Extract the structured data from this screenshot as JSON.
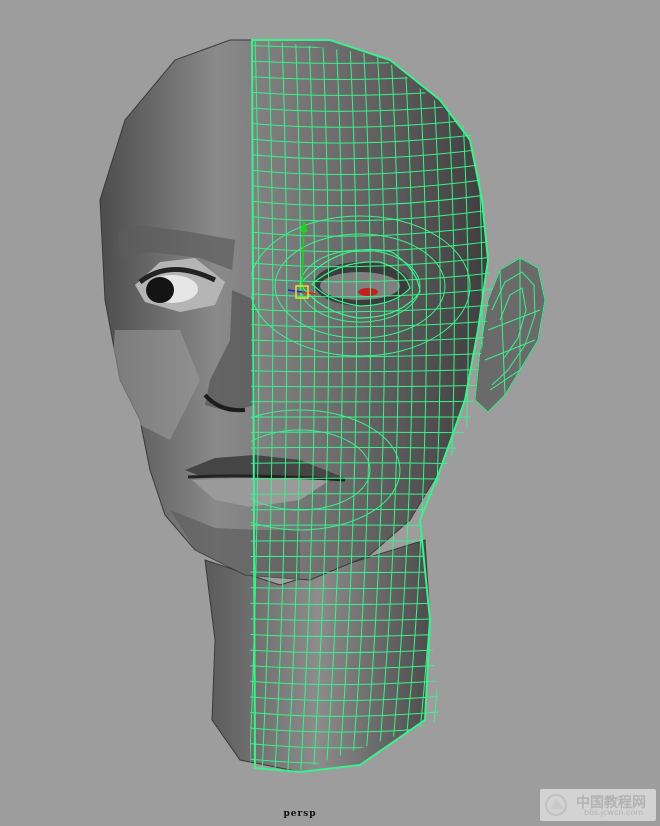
{
  "viewport": {
    "camera_label": "persp",
    "background": "#9d9d9d",
    "wireframe_color": "#3cf08c",
    "mesh_dark": "#4a4a4a",
    "mesh_light": "#8a8a8a"
  },
  "scene": {
    "object": "head-model",
    "selection_highlight": "wireframe-on-shaded"
  },
  "watermark": {
    "name": "中国教程网",
    "url": "bbs.jcwcn.com"
  }
}
